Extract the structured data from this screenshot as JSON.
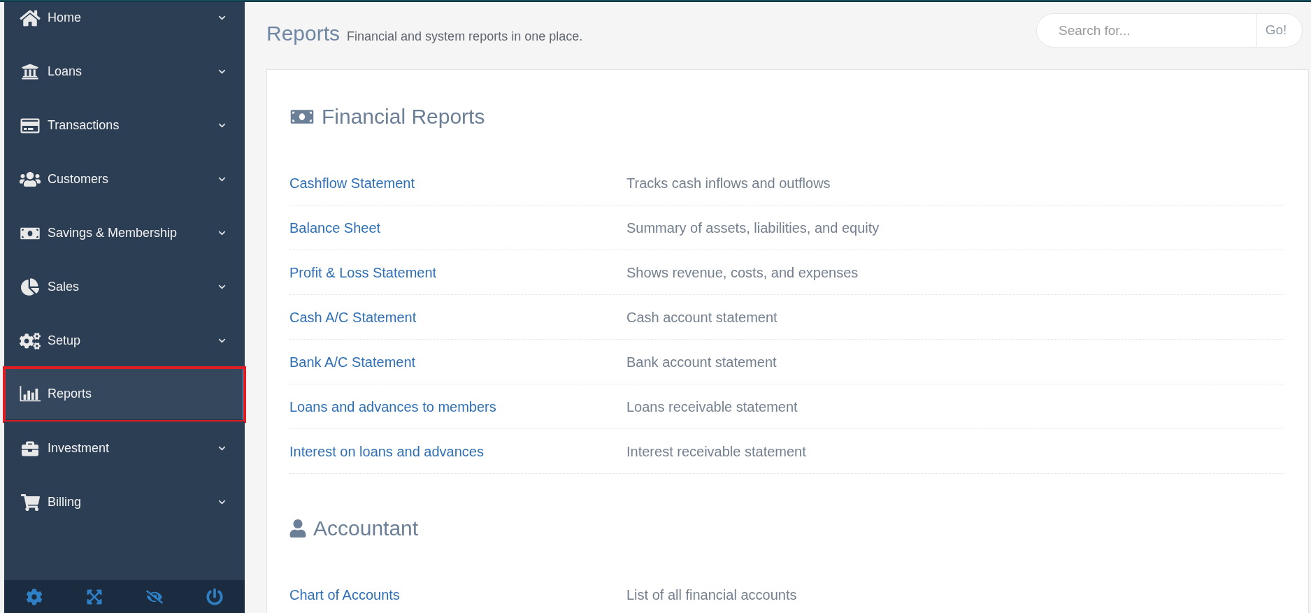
{
  "sidebar": {
    "items": [
      {
        "label": "Home",
        "expandable": true,
        "selected": false
      },
      {
        "label": "Loans",
        "expandable": true,
        "selected": false
      },
      {
        "label": "Transactions",
        "expandable": true,
        "selected": false
      },
      {
        "label": "Customers",
        "expandable": true,
        "selected": false
      },
      {
        "label": "Savings & Membership",
        "expandable": true,
        "selected": false
      },
      {
        "label": "Sales",
        "expandable": true,
        "selected": false
      },
      {
        "label": "Setup",
        "expandable": true,
        "selected": false
      },
      {
        "label": "Reports",
        "expandable": false,
        "selected": true
      },
      {
        "label": "Investment",
        "expandable": true,
        "selected": false
      },
      {
        "label": "Billing",
        "expandable": true,
        "selected": false
      }
    ]
  },
  "header": {
    "title": "Reports",
    "subtitle": "Financial and system reports in one place."
  },
  "search": {
    "placeholder": "Search for...",
    "button": "Go!"
  },
  "sections": [
    {
      "title": "Financial Reports",
      "rows": [
        {
          "name": "Cashflow Statement",
          "description": "Tracks cash inflows and outflows"
        },
        {
          "name": "Balance Sheet",
          "description": "Summary of assets, liabilities, and equity"
        },
        {
          "name": "Profit & Loss Statement",
          "description": "Shows revenue, costs, and expenses"
        },
        {
          "name": "Cash A/C Statement",
          "description": "Cash account statement"
        },
        {
          "name": "Bank A/C Statement",
          "description": "Bank account statement"
        },
        {
          "name": "Loans and advances to members",
          "description": "Loans receivable statement"
        },
        {
          "name": "Interest on loans and advances",
          "description": "Interest receivable statement"
        }
      ]
    },
    {
      "title": "Accountant",
      "rows": [
        {
          "name": "Chart of Accounts",
          "description": "List of all financial accounts"
        }
      ]
    }
  ]
}
